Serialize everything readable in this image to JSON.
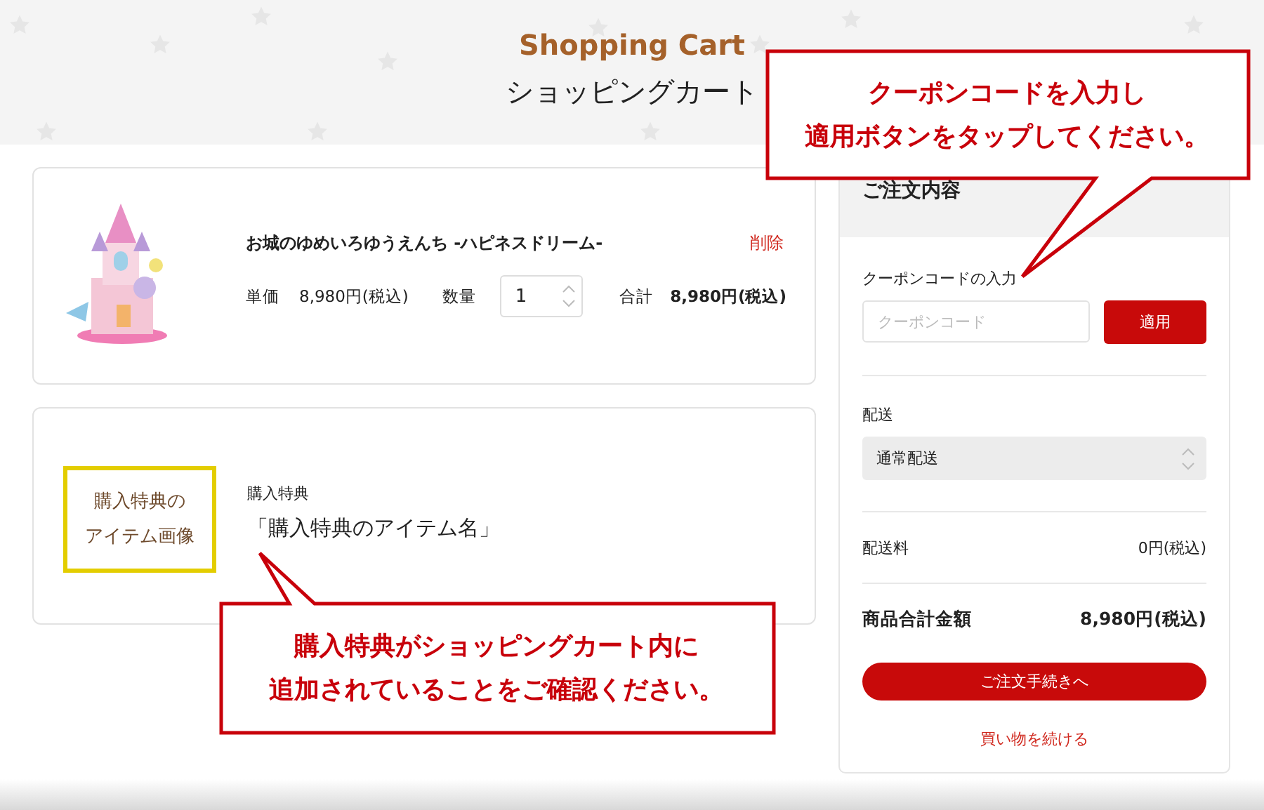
{
  "header": {
    "title_en": "Shopping Cart",
    "title": "ショッピングカート"
  },
  "cart_items": [
    {
      "name": "お城のゆめいろゆうえんち -ハピネスドリーム-",
      "delete": "削除",
      "unit_price_label": "単価",
      "unit_price": "8,980円(税込)",
      "quantity_label": "数量",
      "quantity": "1",
      "total_label": "合計",
      "total": "8,980円(税込)"
    }
  ],
  "bonus": {
    "image_placeholder": [
      "購入特典の",
      "アイテム画像"
    ],
    "label": "購入特典",
    "item_name": "「購入特典のアイテム名」"
  },
  "order_summary": {
    "title": "ご注文内容",
    "coupon_label": "クーポンコードの入力",
    "coupon_field": {
      "placeholder": "クーポンコード"
    },
    "apply_button": "適用",
    "shipping_label": "配送",
    "shipping_method": "通常配送",
    "rows": [
      {
        "kind": "fee",
        "label": "配送料",
        "value": "0円(税込)"
      },
      {
        "kind": "total",
        "label": "商品合計金額",
        "value": "8,980円(税込)"
      }
    ],
    "checkout_button": "ご注文手続きへ",
    "continue_link": "買い物を続ける"
  },
  "callouts": [
    {
      "kind": "down",
      "lines": [
        "クーポンコードを入力し",
        "適用ボタンをタップしてください。"
      ]
    },
    {
      "kind": "up",
      "lines": [
        "購入特典がショッピングカート内に",
        "追加されていることをご確認ください。"
      ]
    }
  ]
}
